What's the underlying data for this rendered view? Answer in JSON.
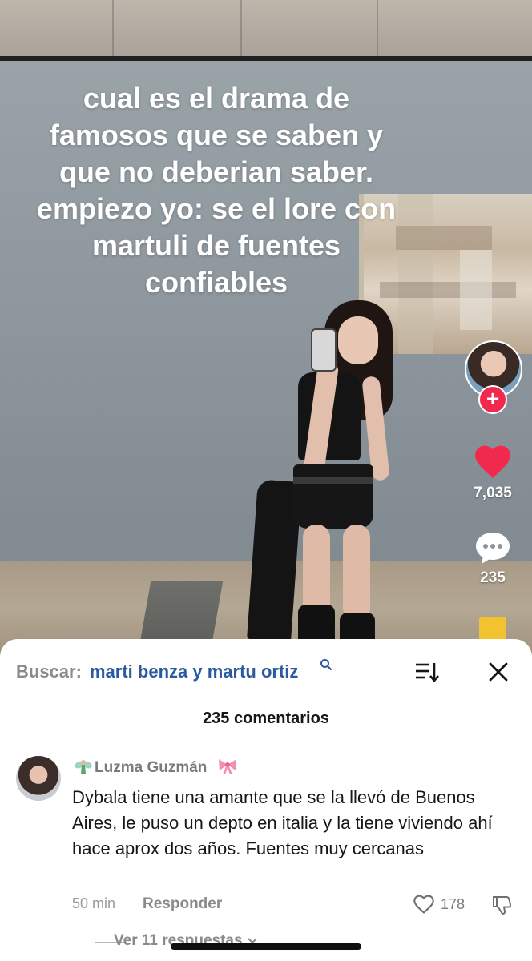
{
  "caption": {
    "text": "cual es el drama de\nfamosos que se saben y\nque no deberian saber.\nempiezo yo: se el lore con\nmartuli de fuentes\nconfiables"
  },
  "rail": {
    "like_count": "7,035",
    "comment_count": "235",
    "follow_symbol": "+",
    "like_color": "#f2294f",
    "follow_color": "#f2294f",
    "bookmark_color": "#f3c230"
  },
  "comments_sheet": {
    "search_label": "Buscar:",
    "search_query": "marti benza y martu ortiz",
    "total_label": "235 comentarios",
    "comment": {
      "author": "Luzma Guzmán",
      "text": "Dybala tiene una amante que se la llevó de Buenos Aires, le puso un depto en italia y la tiene viviendo ahí hace aprox dos años. Fuentes muy cercanas",
      "time": "50 min",
      "reply_label": "Responder",
      "like_count": "178",
      "view_replies": "Ver 11 respuestas"
    },
    "search_query_color": "#2b5a9e"
  },
  "icons": [
    "search-icon",
    "sort-icon",
    "close-icon",
    "heart-icon",
    "comment-bubble-icon",
    "fairy-icon",
    "bow-icon",
    "dislike-icon",
    "chevron-down-icon"
  ]
}
